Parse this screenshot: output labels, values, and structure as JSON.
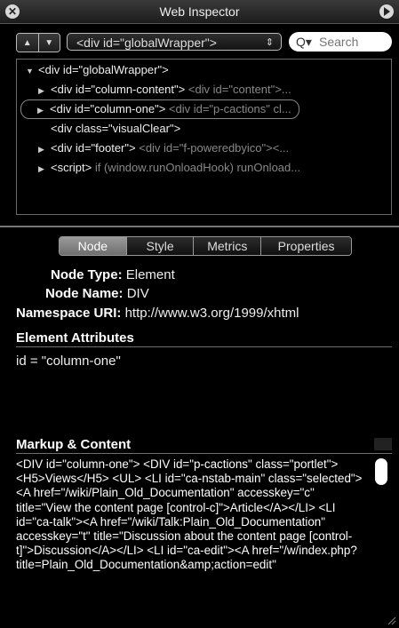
{
  "window": {
    "title": "Web Inspector"
  },
  "toolbar": {
    "back_glyph": "▲",
    "forward_glyph": "▼",
    "selected_node": "<div id=\"globalWrapper\">",
    "select_arrows": "⇕",
    "search_placeholder": "Search",
    "search_icon_glyph": "Q▾"
  },
  "dom_tree": [
    {
      "indent": 0,
      "triangle": "▼",
      "tag": "<div id=\"globalWrapper\">",
      "dim": "",
      "selected": false
    },
    {
      "indent": 1,
      "triangle": "▶",
      "tag": "<div id=\"column-content\">",
      "dim": " <div id=\"content\">...",
      "selected": false
    },
    {
      "indent": 1,
      "triangle": "▶",
      "tag": "<div id=\"column-one\">",
      "dim": " <div id=\"p-cactions\" cl...",
      "selected": true
    },
    {
      "indent": 1,
      "triangle": "",
      "tag": "<div class=\"visualClear\">",
      "dim": "",
      "selected": false
    },
    {
      "indent": 1,
      "triangle": "▶",
      "tag": "<div id=\"footer\">",
      "dim": " <div id=\"f-poweredbyico\"><...",
      "selected": false
    },
    {
      "indent": 1,
      "triangle": "▶",
      "tag": "<script>",
      "dim": " if (window.runOnloadHook) runOnload...",
      "selected": false
    }
  ],
  "tabs": [
    {
      "label": "Node",
      "active": true
    },
    {
      "label": "Style",
      "active": false
    },
    {
      "label": "Metrics",
      "active": false
    },
    {
      "label": "Properties",
      "active": false
    }
  ],
  "node_info": {
    "node_type_label": "Node Type:",
    "node_type_value": "Element",
    "node_name_label": "Node Name:",
    "node_name_value": "DIV",
    "namespace_label": "Namespace URI:",
    "namespace_value": "http://www.w3.org/1999/xhtml"
  },
  "attributes": {
    "heading": "Element Attributes",
    "items": [
      "id = \"column-one\""
    ]
  },
  "markup": {
    "heading": "Markup & Content",
    "content": "<DIV id=\"column-one\"> <DIV id=\"p-cactions\" class=\"portlet\"> <H5>Views</H5> <UL> <LI id=\"ca-nstab-main\" class=\"selected\"><A href=\"/wiki/Plain_Old_Documentation\" accesskey=\"c\" title=\"View the content page [control-c]\">Article</A></LI> <LI id=\"ca-talk\"><A href=\"/wiki/Talk:Plain_Old_Documentation\" accesskey=\"t\" title=\"Discussion about the content page [control-t]\">Discussion</A></LI> <LI id=\"ca-edit\"><A href=\"/w/index.php?title=Plain_Old_Documentation&amp;action=edit\""
  }
}
